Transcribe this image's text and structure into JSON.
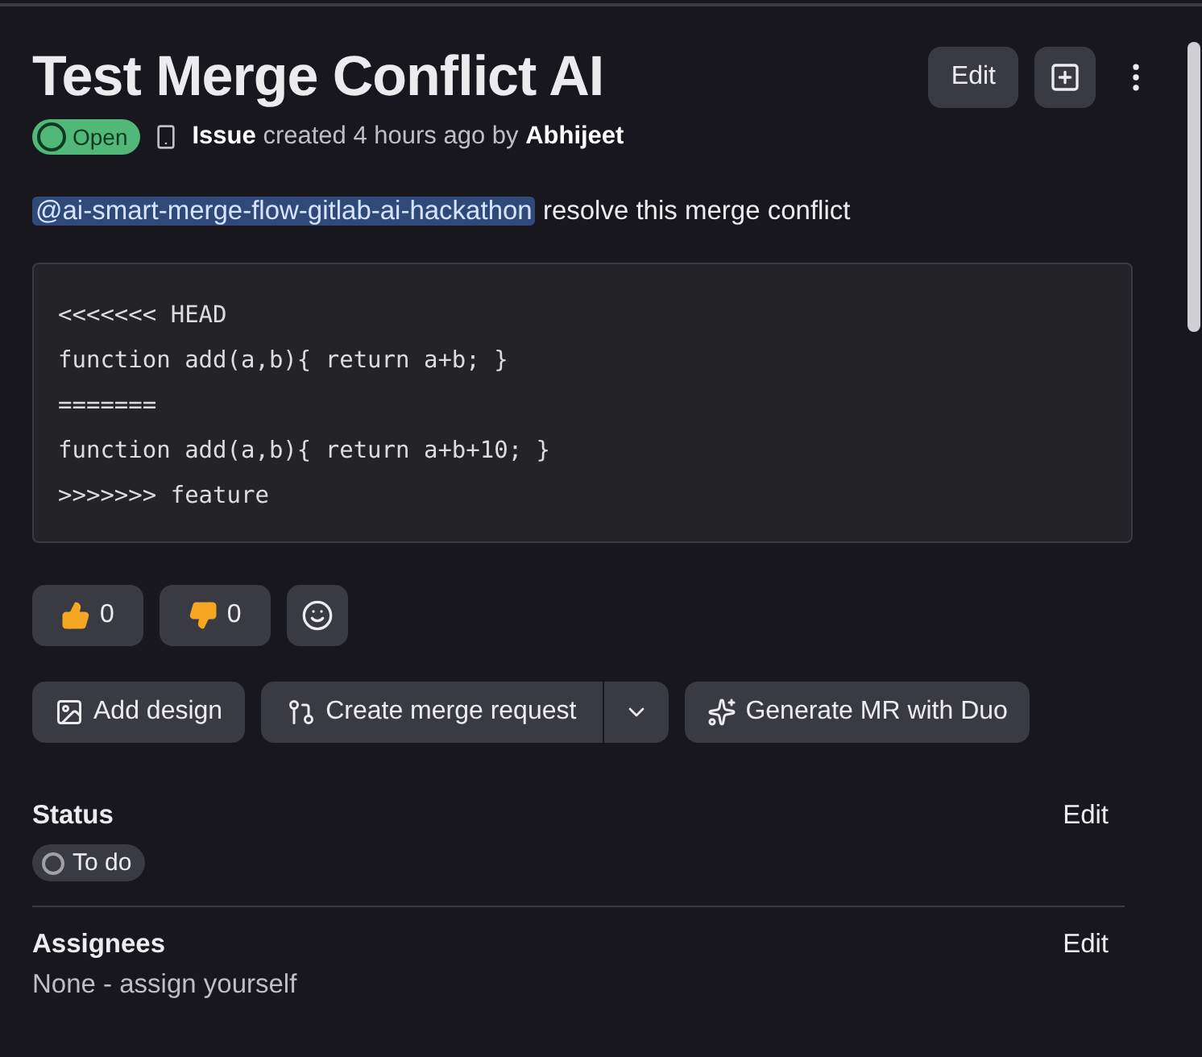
{
  "title": "Test Merge Conflict AI",
  "header_buttons": [
    {
      "kind": "text",
      "label": "Edit"
    },
    {
      "kind": "new_issue"
    },
    {
      "kind": "more"
    }
  ],
  "state_badge": {
    "label": "Open"
  },
  "meta": "**Issue** created 4 hours ago by **Abhijeet**",
  "description": {
    "mention": "@ai-smart-merge-flow-gitlab-ai-hackathon",
    "text": "resolve this merge conflict"
  },
  "code_lines": [
    "<<<<<<< HEAD",
    "function add(a,b){ return a+b; }",
    "=======",
    "function add(a,b){ return a+b+10; }",
    ">>>>>>> feature"
  ],
  "reactions": [
    {
      "kind": "thumbs_up",
      "count": "0"
    },
    {
      "kind": "thumbs_down",
      "count": "0"
    },
    {
      "kind": "add"
    }
  ],
  "actions": [
    {
      "kind": "design",
      "label": "Add design"
    },
    {
      "kind": "merge",
      "label": "Create merge request"
    },
    {
      "kind": "duo",
      "label": "Generate MR with Duo"
    }
  ],
  "sections": [
    {
      "kind": "status",
      "heading": "Status",
      "edit": "Edit",
      "value": "To do"
    },
    {
      "kind": "text",
      "heading": "Assignees",
      "edit": "Edit",
      "value": "None - assign yourself"
    }
  ]
}
